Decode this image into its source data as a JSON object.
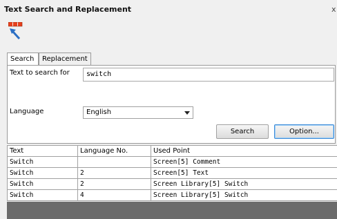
{
  "window": {
    "title": "Text Search and Replacement",
    "close_glyph": "x"
  },
  "toolbar": {
    "icon": "search-replace-tool-icon"
  },
  "tabs": [
    {
      "label": "Search",
      "active": true
    },
    {
      "label": "Replacement",
      "active": false
    }
  ],
  "search": {
    "label": "Text to search for",
    "value": "switch",
    "language_label": "Language",
    "language_value": "English"
  },
  "buttons": {
    "search": "Search",
    "option": "Option..."
  },
  "results": {
    "columns": [
      "Text",
      "Language No.",
      "Used Point"
    ],
    "rows": [
      [
        "Switch",
        "",
        "Screen[5] Comment"
      ],
      [
        "Switch",
        "2",
        "Screen[5] Text"
      ],
      [
        "Switch",
        "2",
        "Screen Library[5] Switch"
      ],
      [
        "Switch",
        "4",
        "Screen Library[5] Switch"
      ]
    ]
  },
  "colors": {
    "icon_red": "#e8401c",
    "icon_arrow": "#2b6fc4",
    "option_focus": "#3c8ad8",
    "footer": "#6b6b6b"
  }
}
